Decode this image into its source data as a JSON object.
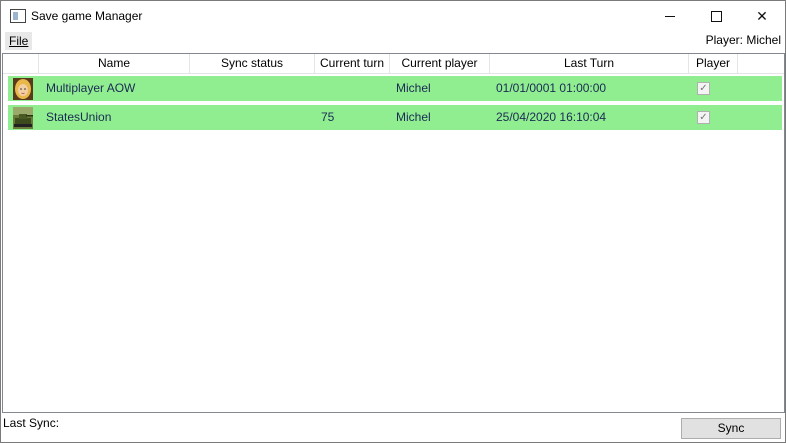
{
  "window": {
    "title": "Save game Manager"
  },
  "menu": {
    "file": "File"
  },
  "player_label": "Player:  Michel",
  "columns": [
    "Name",
    "Sync status",
    "Current turn",
    "Current player",
    "Last Turn",
    "Player"
  ],
  "rows": [
    {
      "avatar": "portrait-avatar",
      "name": "Multiplayer AOW",
      "sync_status": "",
      "current_turn": "",
      "current_player": "Michel",
      "last_turn": "01/01/0001 01:00:00",
      "player_checked": "✓"
    },
    {
      "avatar": "tank-avatar",
      "name": "StatesUnion",
      "sync_status": "",
      "current_turn": "75",
      "current_player": "Michel",
      "last_turn": "25/04/2020 16:10:04",
      "player_checked": "✓"
    }
  ],
  "status": {
    "last_sync": "Last Sync:"
  },
  "sync_button": "Sync",
  "colors": {
    "row_bg": "#90ee90",
    "row_text": "#1a2a55"
  }
}
